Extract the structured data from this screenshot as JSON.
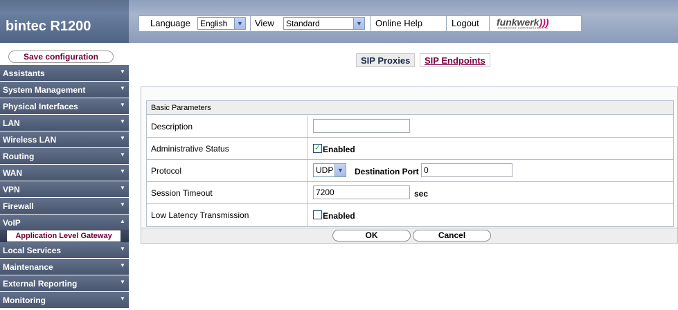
{
  "header": {
    "product": "bintec R1200",
    "language_label": "Language",
    "language_value": "English",
    "view_label": "View",
    "view_value": "Standard",
    "online_help": "Online Help",
    "logout": "Logout",
    "brand_logo": "funkwerk",
    "brand_logo_mark": ")))",
    "brand_tagline": "enterprise communications"
  },
  "sidebar": {
    "save_label": "Save configuration",
    "items": [
      {
        "label": "Assistants",
        "arrow": "▼"
      },
      {
        "label": "System Management",
        "arrow": "▼"
      },
      {
        "label": "Physical Interfaces",
        "arrow": "▼"
      },
      {
        "label": "LAN",
        "arrow": "▼"
      },
      {
        "label": "Wireless LAN",
        "arrow": "▼"
      },
      {
        "label": "Routing",
        "arrow": "▼"
      },
      {
        "label": "WAN",
        "arrow": "▼"
      },
      {
        "label": "VPN",
        "arrow": "▼"
      },
      {
        "label": "Firewall",
        "arrow": "▼"
      },
      {
        "label": "VoIP",
        "arrow": "▲"
      },
      {
        "label": "Local Services",
        "arrow": "▼"
      },
      {
        "label": "Maintenance",
        "arrow": "▼"
      },
      {
        "label": "External Reporting",
        "arrow": "▼"
      },
      {
        "label": "Monitoring",
        "arrow": "▼"
      }
    ],
    "subitem": "Application Level Gateway"
  },
  "tabs": {
    "active": "SIP Proxies",
    "link": "SIP Endpoints"
  },
  "form": {
    "section": "Basic Parameters",
    "description_label": "Description",
    "description_value": "",
    "admin_status_label": "Administrative Status",
    "admin_status_checked": true,
    "admin_status_option": "Enabled",
    "protocol_label": "Protocol",
    "protocol_value": "UDP",
    "destination_port_label": "Destination Port",
    "destination_port_value": "0",
    "session_timeout_label": "Session Timeout",
    "session_timeout_value": "7200",
    "session_timeout_unit": "sec",
    "low_latency_label": "Low Latency Transmission",
    "low_latency_checked": false,
    "low_latency_option": "Enabled"
  },
  "buttons": {
    "ok": "OK",
    "cancel": "Cancel"
  },
  "icons": {
    "dropdown": "▾",
    "check": "✓"
  },
  "colors": {
    "menu_bg": "#56647d",
    "link": "#7a0040",
    "save": "#6b0033"
  }
}
